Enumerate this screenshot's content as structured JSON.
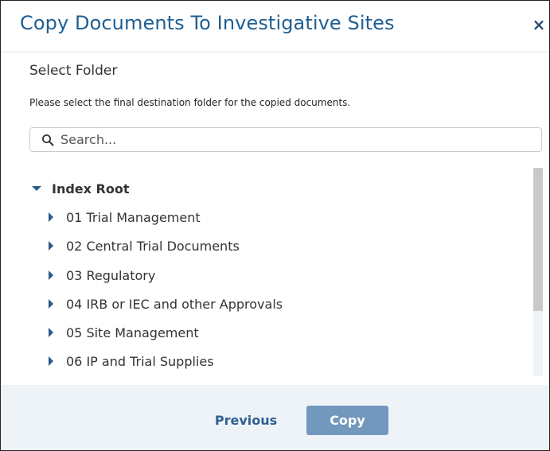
{
  "dialog": {
    "title": "Copy Documents To Investigative Sites",
    "close_label": "×",
    "subtitle": "Select Folder",
    "instructions": "Please select the final destination folder for the copied documents."
  },
  "search": {
    "placeholder": "Search...",
    "value": "",
    "icon": "search-icon"
  },
  "tree": {
    "root": {
      "label": "Index Root",
      "expanded": true,
      "icon": "caret-down-icon"
    },
    "children": [
      {
        "label": "01 Trial Management",
        "expanded": false,
        "icon": "caret-right-icon"
      },
      {
        "label": "02 Central Trial Documents",
        "expanded": false,
        "icon": "caret-right-icon"
      },
      {
        "label": "03 Regulatory",
        "expanded": false,
        "icon": "caret-right-icon"
      },
      {
        "label": "04 IRB or IEC and other Approvals",
        "expanded": false,
        "icon": "caret-right-icon"
      },
      {
        "label": "05 Site Management",
        "expanded": false,
        "icon": "caret-right-icon"
      },
      {
        "label": "06 IP and Trial Supplies",
        "expanded": false,
        "icon": "caret-right-icon"
      }
    ]
  },
  "footer": {
    "previous_label": "Previous",
    "copy_label": "Copy",
    "copy_disabled": true
  },
  "colors": {
    "title": "#1f5f93",
    "caret": "#2b5a86",
    "footer_bg": "#eef3f8",
    "copy_button_bg": "#7398bd",
    "previous_text": "#2f5f8f"
  }
}
